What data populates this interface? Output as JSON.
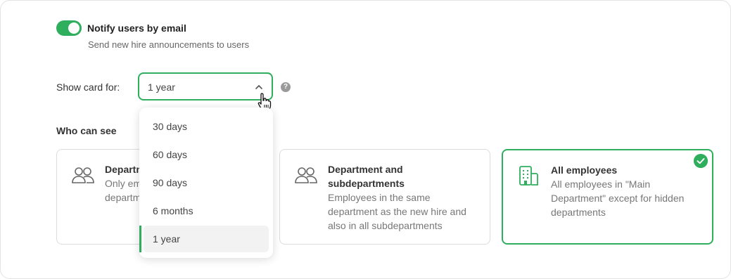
{
  "notify": {
    "title": "Notify users by email",
    "subtitle": "Send new hire announcements to users",
    "enabled": true
  },
  "show_card": {
    "label": "Show card for:",
    "selected": "1 year",
    "help_glyph": "?",
    "options": [
      "30 days",
      "60 days",
      "90 days",
      "6 months",
      "1 year"
    ]
  },
  "who_can_see": {
    "label": "Who can see",
    "cards": [
      {
        "title": "Departm",
        "desc_lines": [
          "Only em",
          "departm"
        ],
        "selected": false
      },
      {
        "title_lines": [
          "Department and",
          "subdepartments"
        ],
        "desc_lines": [
          "Employees in the same",
          "department as the new hire and",
          "also in all subdepartments"
        ],
        "selected": false
      },
      {
        "title": "All employees",
        "desc_lines": [
          "All employees in \"Main",
          "Department\" except for hidden",
          "departments"
        ],
        "selected": true
      }
    ]
  },
  "colors": {
    "accent": "#2fae5e",
    "muted": "#777777"
  }
}
